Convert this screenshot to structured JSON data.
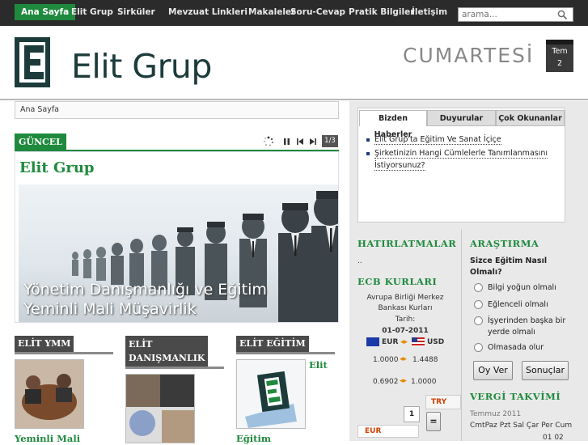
{
  "nav": {
    "items": [
      "Ana Sayfa",
      "Elit Grup",
      "Sirküler",
      "Mevzuat Linkleri",
      "Makaleler",
      "Soru-Cevap",
      "Pratik Bilgiler",
      "İletişim"
    ],
    "search_placeholder": "arama..."
  },
  "header": {
    "logo_text": "Elit Grup",
    "day_name": "CUMARTESİ",
    "cal_month": "Tem",
    "cal_day": "2"
  },
  "breadcrumb": "Ana Sayfa",
  "guncel": {
    "label": "GÜNCEL",
    "counter": "1/3",
    "feature_title": "Elit Grup",
    "caption_line1": "Yönetim Danışmanlığı ve Eğitim",
    "caption_line2": "Yeminli Mali Müşavirlik"
  },
  "sections": [
    {
      "title": "ELİT YMM",
      "link": "Yeminli Mali"
    },
    {
      "title_line1": "ELİT",
      "title_line2": "DANIŞMANLIK"
    },
    {
      "title": "ELİT EĞİTİM",
      "side_link": "Elit",
      "link": "Eğitim"
    }
  ],
  "tabs": [
    "Bizden Haberler",
    "Duyurular",
    "Çok Okunanlar"
  ],
  "news": [
    "Elit Grup'ta Eğitim Ve Sanat İçiçe",
    "Şirketinizin Hangi Cümlelerle Tanımlanmasını",
    "İstiyorsunuz?"
  ],
  "reminders": {
    "title": "HATIRLATMALAR",
    "text": ".."
  },
  "ecb": {
    "title": "ECB KURLARI",
    "line1": "Avrupa Birliği Merkez",
    "line2": "Bankası Kurları",
    "line3": "Tarih:",
    "date": "01-07-2011",
    "cur1": "EUR",
    "cur2": "USD",
    "rate1a": "1.0000",
    "rate1b": "1.4488",
    "rate2a": "0.6902",
    "rate2b": "1.0000"
  },
  "converter": {
    "amount": "1",
    "to": "TRY",
    "from": "EUR",
    "eq": "="
  },
  "poll": {
    "title": "ARAŞTIRMA",
    "question": "Sizce Eğitim Nasıl Olmalı?",
    "options": [
      "Bilgi yoğun olmalı",
      "Eğlenceli olmalı",
      "İşyerinden başka bir",
      "yerde olmalı",
      "Olmasada olur"
    ],
    "vote": "Oy Ver",
    "results": "Sonuçlar"
  },
  "tax": {
    "title": "VERGİ TAKVİMİ",
    "month": "Temmuz 2011",
    "days_header": "CmtPaz Pzt Sal Çar Per Cum",
    "row1": "01 02"
  },
  "colors": {
    "accent": "#1f8a3d",
    "nav_bg": "#2b2b2b"
  }
}
